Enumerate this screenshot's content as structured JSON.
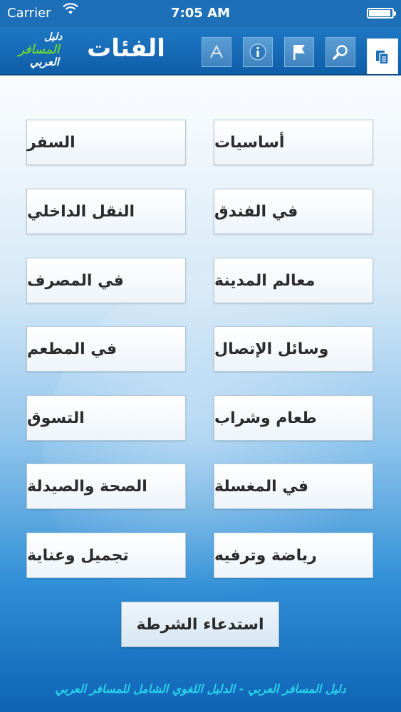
{
  "status_bar": {
    "carrier": "Carrier",
    "time": "7:05 AM",
    "battery_level": 0.95
  },
  "header": {
    "title": "الفئات",
    "logo": {
      "line1": "دليل",
      "line2": "المسافر",
      "line3": "العربي"
    },
    "toolbar_icons": [
      "font-size-icon",
      "info-icon",
      "flag-icon",
      "search-icon",
      "categories-icon"
    ],
    "active_tab": "categories-icon"
  },
  "categories": [
    {
      "right": "أساسيات",
      "left": "السفر"
    },
    {
      "right": "في الفندق",
      "left": "النقل الداخلي"
    },
    {
      "right": "معالم المدينة",
      "left": "في المصرف"
    },
    {
      "right": "وسائل الإتصال",
      "left": "في المطعم"
    },
    {
      "right": "طعام وشراب",
      "left": "التسوق"
    },
    {
      "right": "في المغسلة",
      "left": "الصحة والصيدلة"
    },
    {
      "right": "رياضة وترفيه",
      "left": "تجميل وعناية"
    }
  ],
  "police_button": "استدعاء الشرطة",
  "footer": "دليل المسافر العربي - الدليل اللغوي الشامل للمسافر العربي",
  "colors": {
    "header": "#1d6fb8",
    "footer_text": "#27d3e8",
    "logo_green": "#67d13a"
  }
}
